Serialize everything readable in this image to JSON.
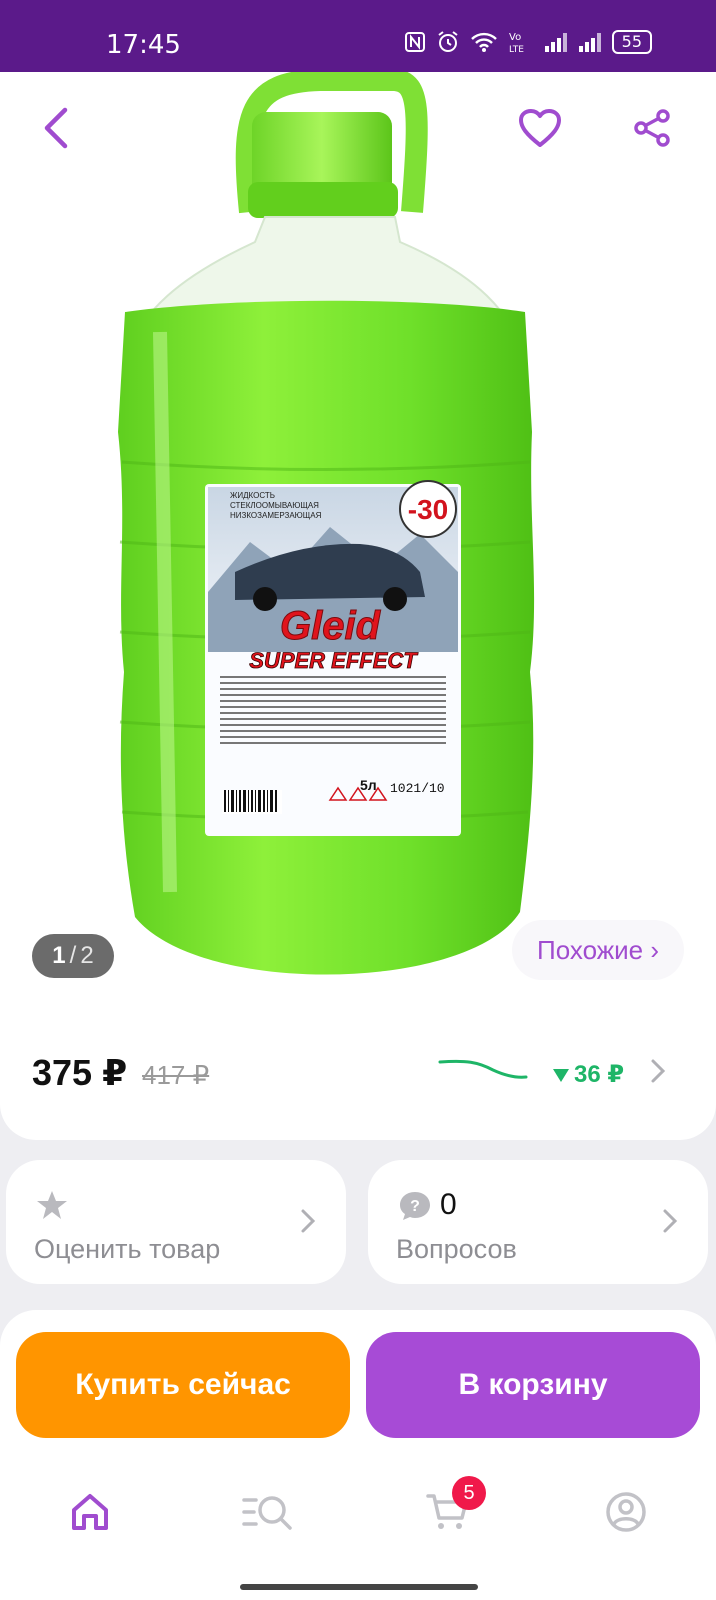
{
  "status_bar": {
    "time": "17:45",
    "battery": "55",
    "icons": [
      "nfc-icon",
      "alarm-icon",
      "wifi-icon",
      "volte-icon",
      "signal-icon",
      "signal-icon",
      "battery-icon"
    ]
  },
  "product": {
    "image_label_texts": {
      "brand": "Gleid",
      "line": "SUPER EFFECT",
      "temp": "-30",
      "volume": "5л",
      "code": "1021/10",
      "descriptor_1": "ЖИДКОСТЬ",
      "descriptor_2": "СТЕКЛООМЫВАЮЩАЯ",
      "descriptor_3": "НИЗКОЗАМЕРЗАЮЩАЯ"
    },
    "gallery": {
      "current": "1",
      "separator": "/",
      "total": "2"
    },
    "similar_label": "Похожие ›"
  },
  "price": {
    "current": "375 ₽",
    "old": "417 ₽",
    "drop": "36 ₽",
    "drop_icon": "triangle-down-icon",
    "colors": {
      "drop": "#1eb567",
      "trend": "#1eb567"
    }
  },
  "rating_card": {
    "label": "Оценить товар",
    "icon": "star-icon"
  },
  "questions_card": {
    "count": "0",
    "label": "Вопросов",
    "icon": "question-icon"
  },
  "actions": {
    "buy_now": "Купить сейчас",
    "add_to_cart": "В корзину",
    "colors": {
      "buy_now": "#ff9500",
      "add_to_cart": "#a74bd6"
    }
  },
  "bottom_nav": {
    "items": [
      "home-icon",
      "catalog-search-icon",
      "cart-icon",
      "profile-icon"
    ],
    "cart_badge": "5",
    "accent": "#a04ccf"
  }
}
